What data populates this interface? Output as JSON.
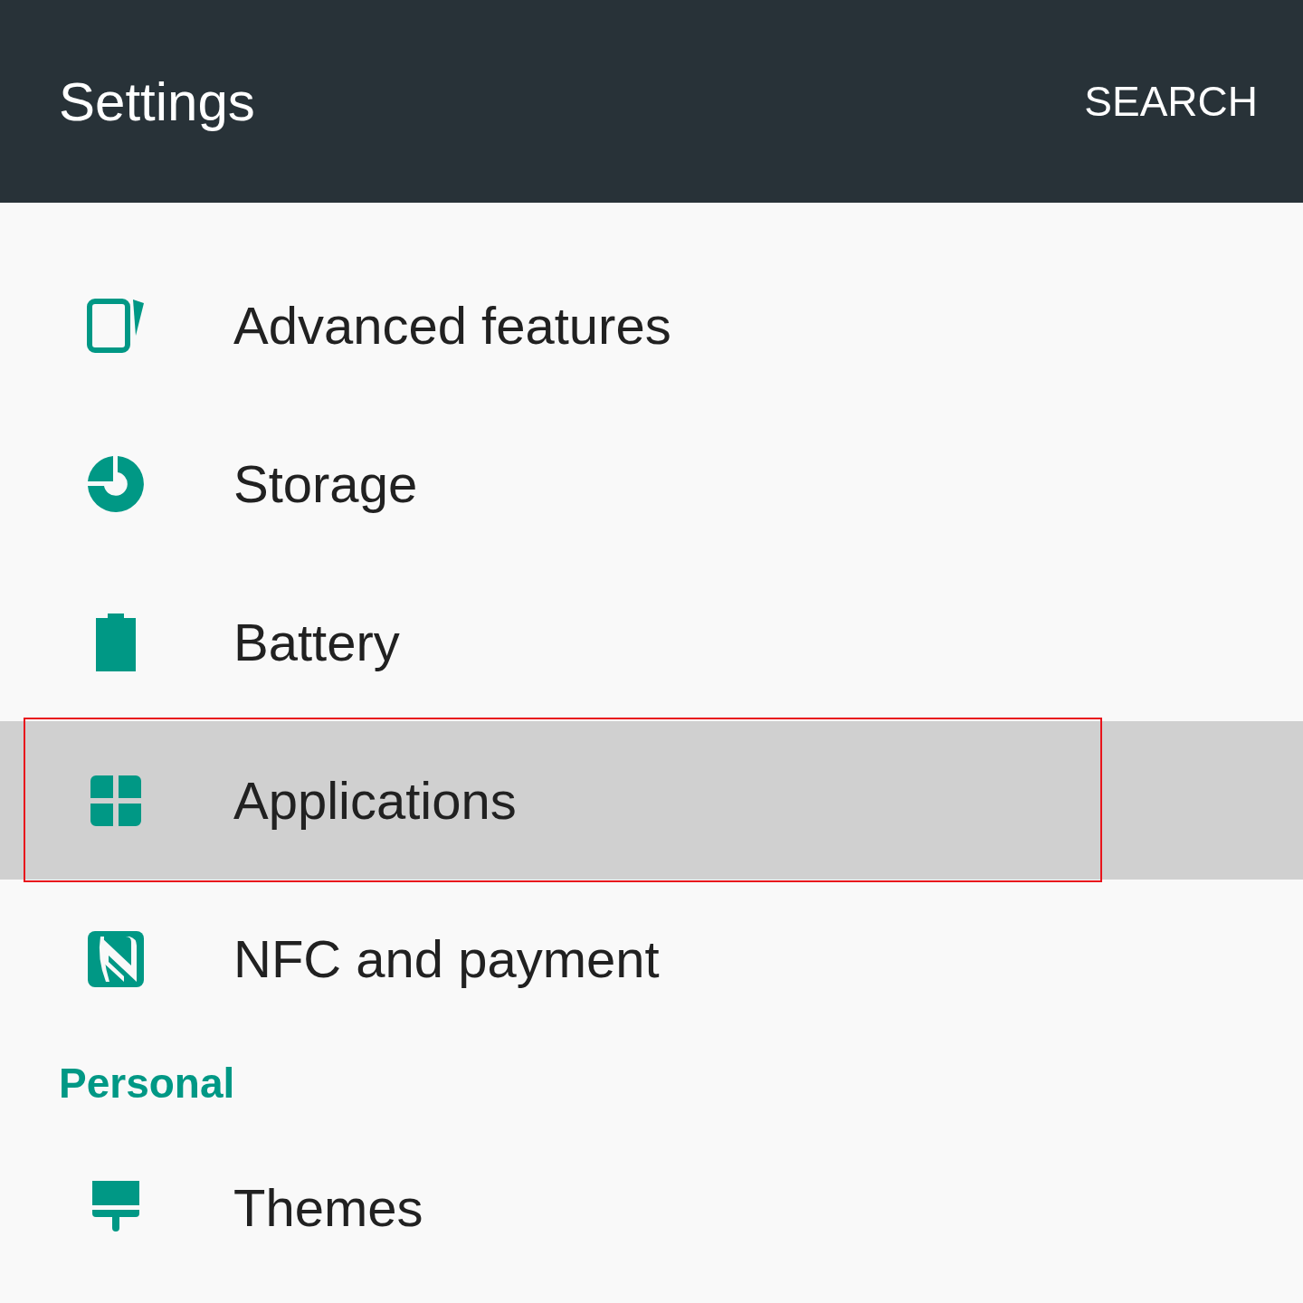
{
  "app_bar": {
    "title": "Settings",
    "action": "SEARCH"
  },
  "items": [
    {
      "kind": "phone-edge",
      "label": "Advanced features",
      "selected": false,
      "highlighted": false
    },
    {
      "kind": "storage",
      "label": "Storage",
      "selected": false,
      "highlighted": false
    },
    {
      "kind": "battery",
      "label": "Battery",
      "selected": false,
      "highlighted": false
    },
    {
      "kind": "apps",
      "label": "Applications",
      "selected": true,
      "highlighted": true
    },
    {
      "kind": "nfc",
      "label": "NFC and payment",
      "selected": false,
      "highlighted": false
    }
  ],
  "sections": [
    {
      "title": "Personal",
      "items": [
        {
          "kind": "themes",
          "label": "Themes",
          "selected": false,
          "highlighted": false
        }
      ]
    }
  ]
}
